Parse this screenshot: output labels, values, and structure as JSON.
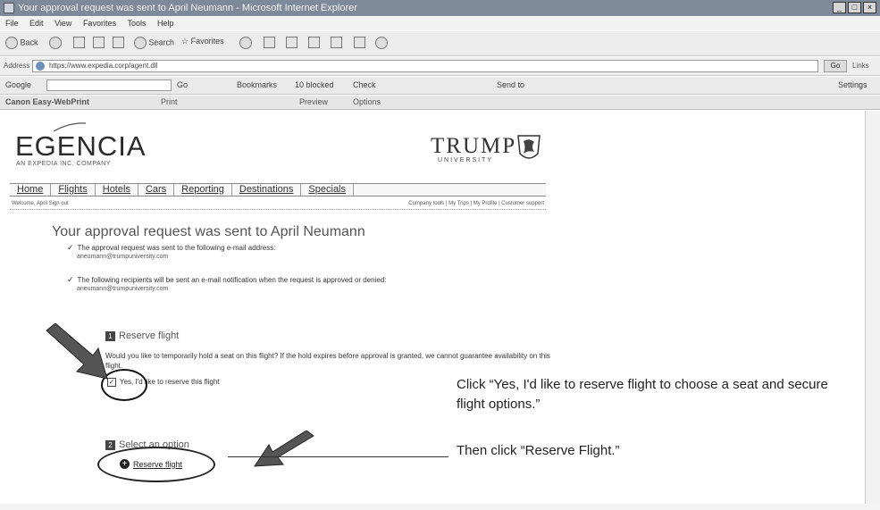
{
  "browser": {
    "window_title": "Your approval request was sent to April Neumann - Microsoft Internet Explorer",
    "menu": [
      "File",
      "Edit",
      "View",
      "Favorites",
      "Tools",
      "Help"
    ],
    "toolbar": {
      "back": "Back",
      "search": "Search",
      "favorites": "Favorites"
    },
    "address_label": "Address",
    "address_value": "https://www.expedia.corp/agent.dll",
    "go_label": "Go",
    "links_label": "Links",
    "google": {
      "label": "Google",
      "go": "Go",
      "bookmarks": "Bookmarks",
      "blocked": "10 blocked",
      "check": "Check",
      "send_to": "Send to",
      "settings": "Settings"
    },
    "canon": {
      "label": "Canon Easy-WebPrint",
      "print": "Print",
      "preview": "Preview",
      "options": "Options"
    }
  },
  "site": {
    "logo_main": "EGENCIA",
    "logo_sub": "AN EXPEDIA INC. COMPANY",
    "partner_logo": "TRUMP",
    "partner_sub": "UNIVERSITY",
    "nav": [
      "Home",
      "Flights",
      "Hotels",
      "Cars",
      "Reporting",
      "Destinations",
      "Specials"
    ],
    "welcome": "Welcome, April Sign out",
    "user_links": "Company tools | My Trips | My Profile | Customer support"
  },
  "content": {
    "heading": "Your approval request was sent to April Neumann",
    "item1": "The approval request was sent to the following e-mail address:",
    "email1": "aneumann@trumpuniversity.com",
    "item2": "The following recipients will be sent an e-mail notification when the request is approved or denied:",
    "email2": "aneumann@trumpuniversity.com",
    "section1_num": "1",
    "section1_title": "Reserve flight",
    "section1_text": "Would you like to temporarily hold a seat on this flight? If the hold expires before approval is granted, we cannot guarantee availability on this flight.",
    "checkbox_label": "Yes, I'd like to reserve this flight",
    "section2_num": "2",
    "section2_title": "Select an option",
    "reserve_button": "Reserve flight"
  },
  "annotations": {
    "instruction1": "Click “Yes, I'd like to reserve flight to choose a seat and secure flight options.”",
    "instruction2": "Then click “Reserve Flight.”"
  }
}
